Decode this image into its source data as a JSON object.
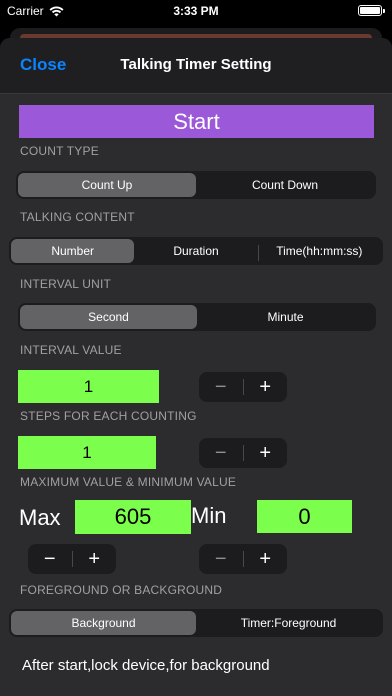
{
  "status_bar": {
    "carrier": "Carrier",
    "time": "3:33 PM"
  },
  "nav": {
    "close_label": "Close",
    "title": "Talking Timer Setting"
  },
  "start_label": "Start",
  "count_type": {
    "label": "COUNT TYPE",
    "options": [
      "Count Up",
      "Count Down"
    ],
    "selected": "Count Up"
  },
  "talking_content": {
    "label": "TALKING CONTENT",
    "options": [
      "Number",
      "Duration",
      "Time(hh:mm:ss)"
    ],
    "selected": "Number"
  },
  "interval_unit": {
    "label": "INTERVAL UNIT",
    "options": [
      "Second",
      "Minute"
    ],
    "selected": "Second"
  },
  "interval_value": {
    "label": "INTERVAL VALUE",
    "value": "1"
  },
  "steps": {
    "label": "STEPS FOR EACH COUNTING",
    "value": "1"
  },
  "max_min": {
    "label": "MAXIMUM VALUE &  MINIMUM VALUE",
    "max_label": "Max",
    "max_value": "605",
    "min_label": "Min",
    "min_value": "0"
  },
  "stepper_glyphs": {
    "minus": "−",
    "plus": "+"
  },
  "fg_bg": {
    "label": "FOREGROUND OR BACKGROUND",
    "options": [
      "Background",
      "Timer:Foreground"
    ],
    "selected": "Background"
  },
  "footer_text": "After start,lock device,for background",
  "colors": {
    "accent": "#0a84ff",
    "start_button": "#9b59d9",
    "value_field": "#7cff4c"
  }
}
